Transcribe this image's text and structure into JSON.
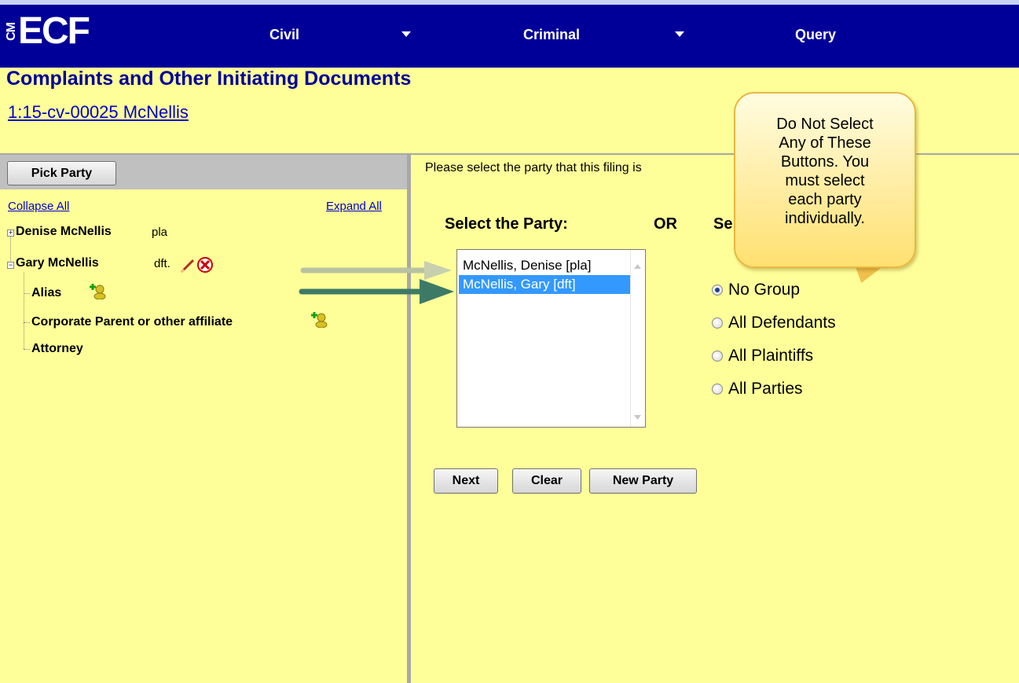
{
  "nav": {
    "logo_cm": "CM",
    "logo_ecf": "ECF",
    "civil": "Civil",
    "criminal": "Criminal",
    "query": "Query"
  },
  "page": {
    "title": "Complaints and Other Initiating Documents",
    "case_link": "1:15-cv-00025 McNellis"
  },
  "left_panel": {
    "pick_party": "Pick Party",
    "collapse_all": "Collapse All",
    "expand_all": "Expand All",
    "tree": {
      "party1_name": "Denise McNellis",
      "party1_role": "pla",
      "party2_name": "Gary McNellis",
      "party2_role": "dft.",
      "alias": "Alias",
      "corporate_parent": "Corporate Parent or other affiliate",
      "attorney": "Attorney"
    }
  },
  "main": {
    "instruction": "Please select the party that this filing is",
    "select_party_title": "Select the Party:",
    "or_label": "OR",
    "select_group_partial": "Se",
    "party_list": [
      "McNellis, Denise [pla]",
      "McNellis, Gary [dft]"
    ],
    "selected_index": 1,
    "group_options": [
      "No Group",
      "All Defendants",
      "All Plaintiffs",
      "All Parties"
    ],
    "group_selected": "No Group",
    "buttons": {
      "next": "Next",
      "clear": "Clear",
      "new_party": "New Party"
    }
  },
  "callout": {
    "line1": "Do Not Select",
    "line2": "Any of These",
    "line3": "Buttons. You",
    "line4": "must select",
    "line5": "each party",
    "line6": "individually."
  },
  "colors": {
    "nav_bg": "#000099",
    "page_bg": "#ffff99",
    "title": "#000099",
    "link": "#0000cc",
    "selection": "#3399ff",
    "arrow": "#3d7a66"
  }
}
